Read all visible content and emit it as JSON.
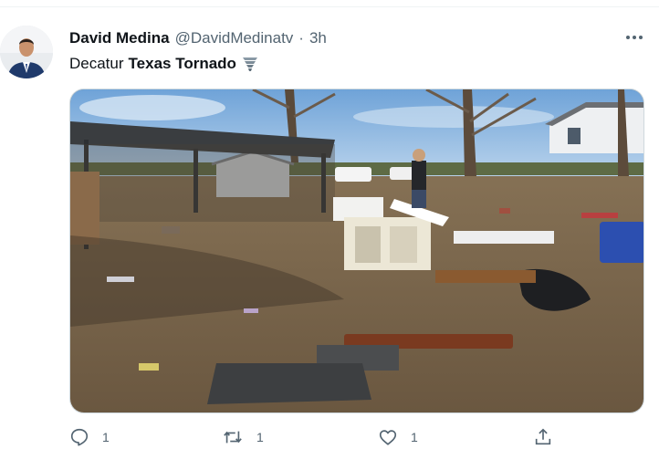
{
  "tweet": {
    "author_name": "David Medina",
    "author_handle": "@DavidMedinatv",
    "separator": "·",
    "timestamp": "3h",
    "text_plain": "Decatur",
    "text_bold": "Texas Tornado",
    "emoji_icon": "tornado-icon"
  },
  "media": {
    "type": "photo",
    "scene": "tornado-damage"
  },
  "actions": {
    "reply_count": "1",
    "retweet_count": "1",
    "like_count": "1",
    "share_icon": "share-icon"
  },
  "colors": {
    "secondary_text": "#536471",
    "primary_text": "#0f1419",
    "border": "#cfd9de"
  }
}
